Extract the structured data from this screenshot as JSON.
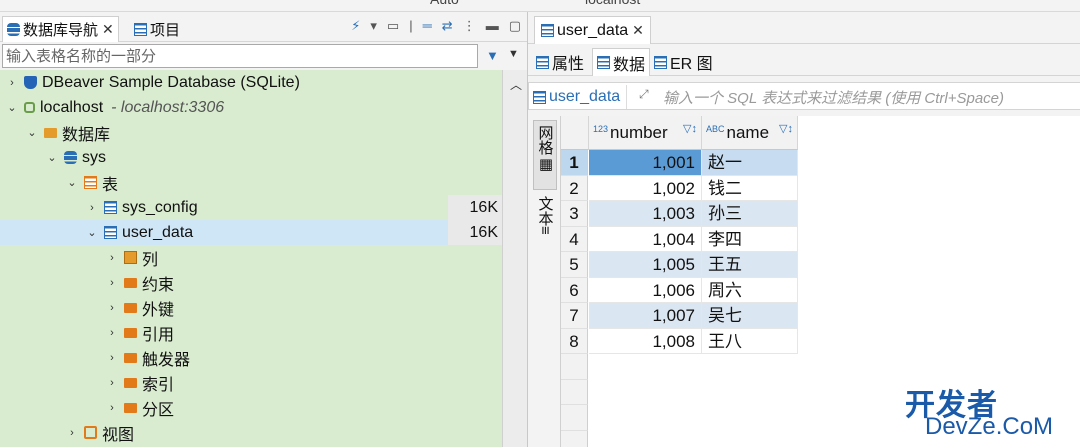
{
  "left_panel": {
    "tabs": [
      {
        "label": "数据库导航",
        "active": true
      },
      {
        "label": "项目",
        "active": false
      }
    ],
    "filter_placeholder": "输入表格名称的一部分",
    "tree": {
      "sample_db": "DBeaver Sample Database (SQLite)",
      "localhost": "localhost",
      "localhost_detail": "- localhost:3306",
      "databases": "数据库",
      "sys": "sys",
      "tables": "表",
      "sys_config": "sys_config",
      "sys_config_size": "16K",
      "user_data": "user_data",
      "user_data_size": "16K",
      "columns": "列",
      "constraints": "约束",
      "foreign_keys": "外键",
      "references": "引用",
      "triggers": "触发器",
      "indexes": "索引",
      "partitions": "分区",
      "views": "视图"
    }
  },
  "editor": {
    "tab_label": "user_data",
    "subtabs": [
      {
        "label": "属性",
        "active": false
      },
      {
        "label": "数据",
        "active": true
      },
      {
        "label": "ER 图",
        "active": false
      }
    ],
    "filter": {
      "table_name": "user_data",
      "placeholder": "输入一个 SQL 表达式来过滤结果 (使用 Ctrl+Space)"
    },
    "view_tabs": [
      {
        "label": "网格",
        "active": true
      },
      {
        "label": "文本",
        "active": false
      }
    ],
    "columns": [
      {
        "type_tag": "123",
        "name": "number"
      },
      {
        "type_tag": "ABC",
        "name": "name"
      }
    ],
    "rows": [
      {
        "idx": "1",
        "number": "1,001",
        "name": "赵一"
      },
      {
        "idx": "2",
        "number": "1,002",
        "name": "钱二"
      },
      {
        "idx": "3",
        "number": "1,003",
        "name": "孙三"
      },
      {
        "idx": "4",
        "number": "1,004",
        "name": "李四"
      },
      {
        "idx": "5",
        "number": "1,005",
        "name": "王五"
      },
      {
        "idx": "6",
        "number": "1,006",
        "name": "周六"
      },
      {
        "idx": "7",
        "number": "1,007",
        "name": "吴七"
      },
      {
        "idx": "8",
        "number": "1,008",
        "name": "王八"
      }
    ]
  },
  "watermark": {
    "line1": "开发者",
    "line2": "DevZe.CoM"
  },
  "colors": {
    "tree_bg": "#d9ecd0",
    "selection": "#cfe6f7",
    "accent": "#2a6fb5"
  }
}
